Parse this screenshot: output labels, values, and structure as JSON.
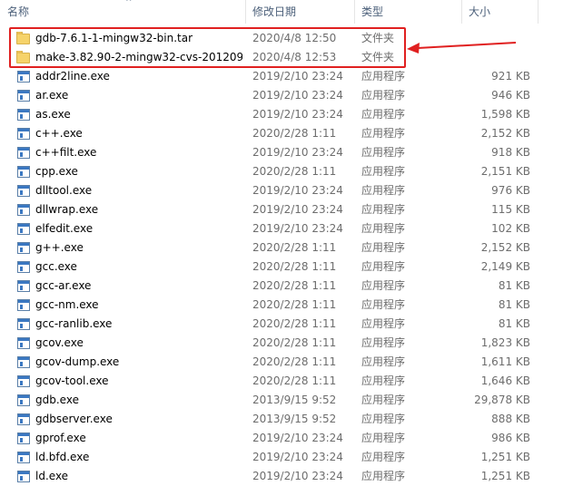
{
  "header": {
    "name": "名称",
    "date": "修改日期",
    "type": "类型",
    "size": "大小",
    "sort_indicator": "^"
  },
  "files": [
    {
      "icon": "folder-icon",
      "name": "gdb-7.6.1-1-mingw32-bin.tar",
      "date": "2020/4/8 12:50",
      "type": "文件夹",
      "size": ""
    },
    {
      "icon": "folder-icon",
      "name": "make-3.82.90-2-mingw32-cvs-201209...",
      "date": "2020/4/8 12:53",
      "type": "文件夹",
      "size": ""
    },
    {
      "icon": "exe-icon",
      "name": "addr2line.exe",
      "date": "2019/2/10 23:24",
      "type": "应用程序",
      "size": "921 KB"
    },
    {
      "icon": "exe-icon",
      "name": "ar.exe",
      "date": "2019/2/10 23:24",
      "type": "应用程序",
      "size": "946 KB"
    },
    {
      "icon": "exe-icon",
      "name": "as.exe",
      "date": "2019/2/10 23:24",
      "type": "应用程序",
      "size": "1,598 KB"
    },
    {
      "icon": "exe-icon",
      "name": "c++.exe",
      "date": "2020/2/28 1:11",
      "type": "应用程序",
      "size": "2,152 KB"
    },
    {
      "icon": "exe-icon",
      "name": "c++filt.exe",
      "date": "2019/2/10 23:24",
      "type": "应用程序",
      "size": "918 KB"
    },
    {
      "icon": "exe-icon",
      "name": "cpp.exe",
      "date": "2020/2/28 1:11",
      "type": "应用程序",
      "size": "2,151 KB"
    },
    {
      "icon": "exe-icon",
      "name": "dlltool.exe",
      "date": "2019/2/10 23:24",
      "type": "应用程序",
      "size": "976 KB"
    },
    {
      "icon": "exe-icon",
      "name": "dllwrap.exe",
      "date": "2019/2/10 23:24",
      "type": "应用程序",
      "size": "115 KB"
    },
    {
      "icon": "exe-icon",
      "name": "elfedit.exe",
      "date": "2019/2/10 23:24",
      "type": "应用程序",
      "size": "102 KB"
    },
    {
      "icon": "exe-icon",
      "name": "g++.exe",
      "date": "2020/2/28 1:11",
      "type": "应用程序",
      "size": "2,152 KB"
    },
    {
      "icon": "exe-icon",
      "name": "gcc.exe",
      "date": "2020/2/28 1:11",
      "type": "应用程序",
      "size": "2,149 KB"
    },
    {
      "icon": "exe-icon",
      "name": "gcc-ar.exe",
      "date": "2020/2/28 1:11",
      "type": "应用程序",
      "size": "81 KB"
    },
    {
      "icon": "exe-icon",
      "name": "gcc-nm.exe",
      "date": "2020/2/28 1:11",
      "type": "应用程序",
      "size": "81 KB"
    },
    {
      "icon": "exe-icon",
      "name": "gcc-ranlib.exe",
      "date": "2020/2/28 1:11",
      "type": "应用程序",
      "size": "81 KB"
    },
    {
      "icon": "exe-icon",
      "name": "gcov.exe",
      "date": "2020/2/28 1:11",
      "type": "应用程序",
      "size": "1,823 KB"
    },
    {
      "icon": "exe-icon",
      "name": "gcov-dump.exe",
      "date": "2020/2/28 1:11",
      "type": "应用程序",
      "size": "1,611 KB"
    },
    {
      "icon": "exe-icon",
      "name": "gcov-tool.exe",
      "date": "2020/2/28 1:11",
      "type": "应用程序",
      "size": "1,646 KB"
    },
    {
      "icon": "exe-icon",
      "name": "gdb.exe",
      "date": "2013/9/15 9:52",
      "type": "应用程序",
      "size": "29,878 KB"
    },
    {
      "icon": "exe-icon",
      "name": "gdbserver.exe",
      "date": "2013/9/15 9:52",
      "type": "应用程序",
      "size": "888 KB"
    },
    {
      "icon": "exe-icon",
      "name": "gprof.exe",
      "date": "2019/2/10 23:24",
      "type": "应用程序",
      "size": "986 KB"
    },
    {
      "icon": "exe-icon",
      "name": "ld.bfd.exe",
      "date": "2019/2/10 23:24",
      "type": "应用程序",
      "size": "1,251 KB"
    },
    {
      "icon": "exe-icon",
      "name": "ld.exe",
      "date": "2019/2/10 23:24",
      "type": "应用程序",
      "size": "1,251 KB"
    }
  ],
  "colors": {
    "highlight_box": "#e02020",
    "annotation_arrow": "#e02020",
    "header_text": "#4c607a",
    "secondary_text": "#6d6d6d"
  }
}
